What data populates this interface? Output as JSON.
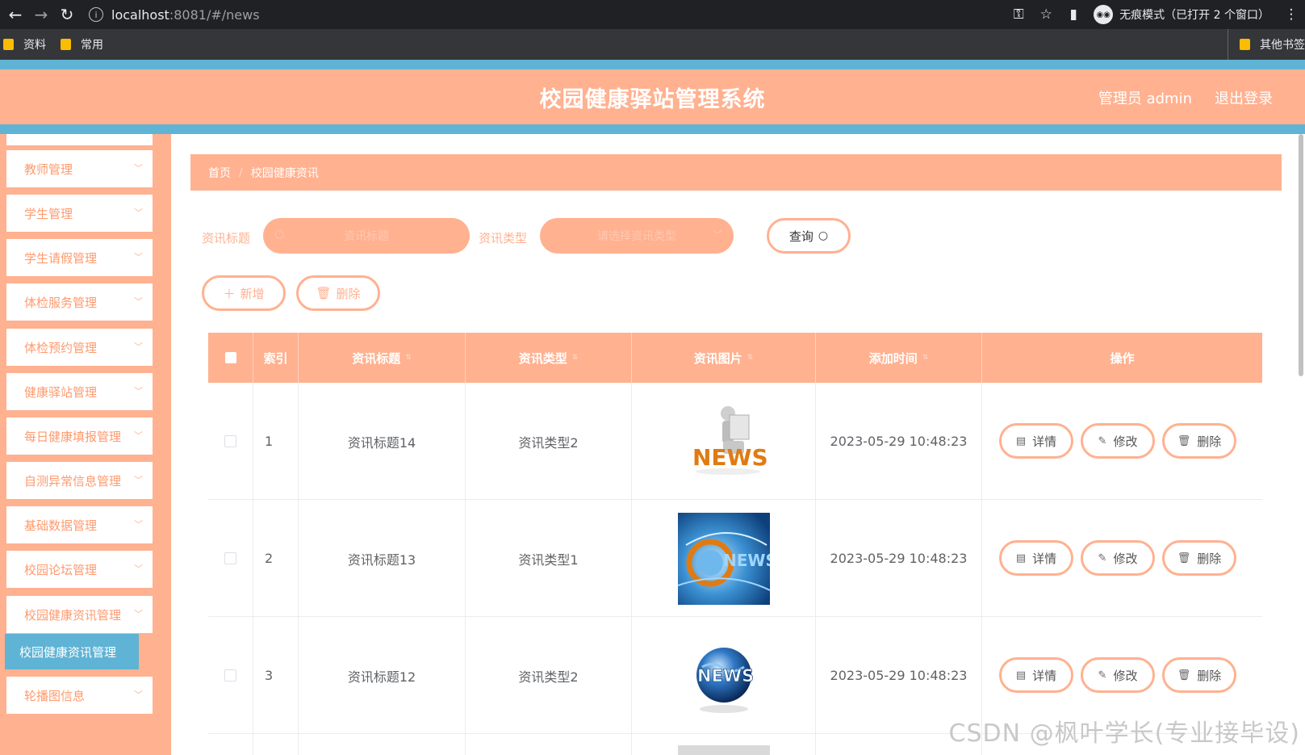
{
  "browser": {
    "url_host": "localhost",
    "url_rest": ":8081/#/news",
    "incognito_label": "无痕模式（已打开 2 个窗口）",
    "bookmarks": [
      "资料",
      "常用"
    ],
    "other_bookmarks": "其他书签"
  },
  "header": {
    "title": "校园健康驿站管理系统",
    "user": "管理员 admin",
    "logout": "退出登录"
  },
  "sidebar": {
    "items": [
      "教师管理",
      "学生管理",
      "学生请假管理",
      "体检服务管理",
      "体检预约管理",
      "健康驿站管理",
      "每日健康填报管理",
      "自测异常信息管理",
      "基础数据管理",
      "校园论坛管理",
      "校园健康资讯管理"
    ],
    "active_sub": "校园健康资讯管理",
    "last_item": "轮播图信息"
  },
  "breadcrumb": {
    "home": "首页",
    "current": "校园健康资讯"
  },
  "search": {
    "title_label": "资讯标题",
    "title_placeholder": "资讯标题",
    "type_label": "资讯类型",
    "type_placeholder": "请选择资讯类型",
    "query_label": "查询"
  },
  "actions": {
    "add": "新增",
    "delete": "删除"
  },
  "table": {
    "columns": [
      "索引",
      "资讯标题",
      "资讯类型",
      "资讯图片",
      "添加时间",
      "操作"
    ],
    "rows": [
      {
        "index": "1",
        "title": "资讯标题14",
        "type": "资讯类型2",
        "time": "2023-05-29 10:48:23"
      },
      {
        "index": "2",
        "title": "资讯标题13",
        "type": "资讯类型1",
        "time": "2023-05-29 10:48:23"
      },
      {
        "index": "3",
        "title": "资讯标题12",
        "type": "资讯类型2",
        "time": "2023-05-29 10:48:23"
      }
    ],
    "row_actions": {
      "detail": "详情",
      "edit": "修改",
      "delete": "删除"
    },
    "image_text": "NEWS"
  },
  "watermark": "CSDN @枫叶学长(专业接毕设)"
}
